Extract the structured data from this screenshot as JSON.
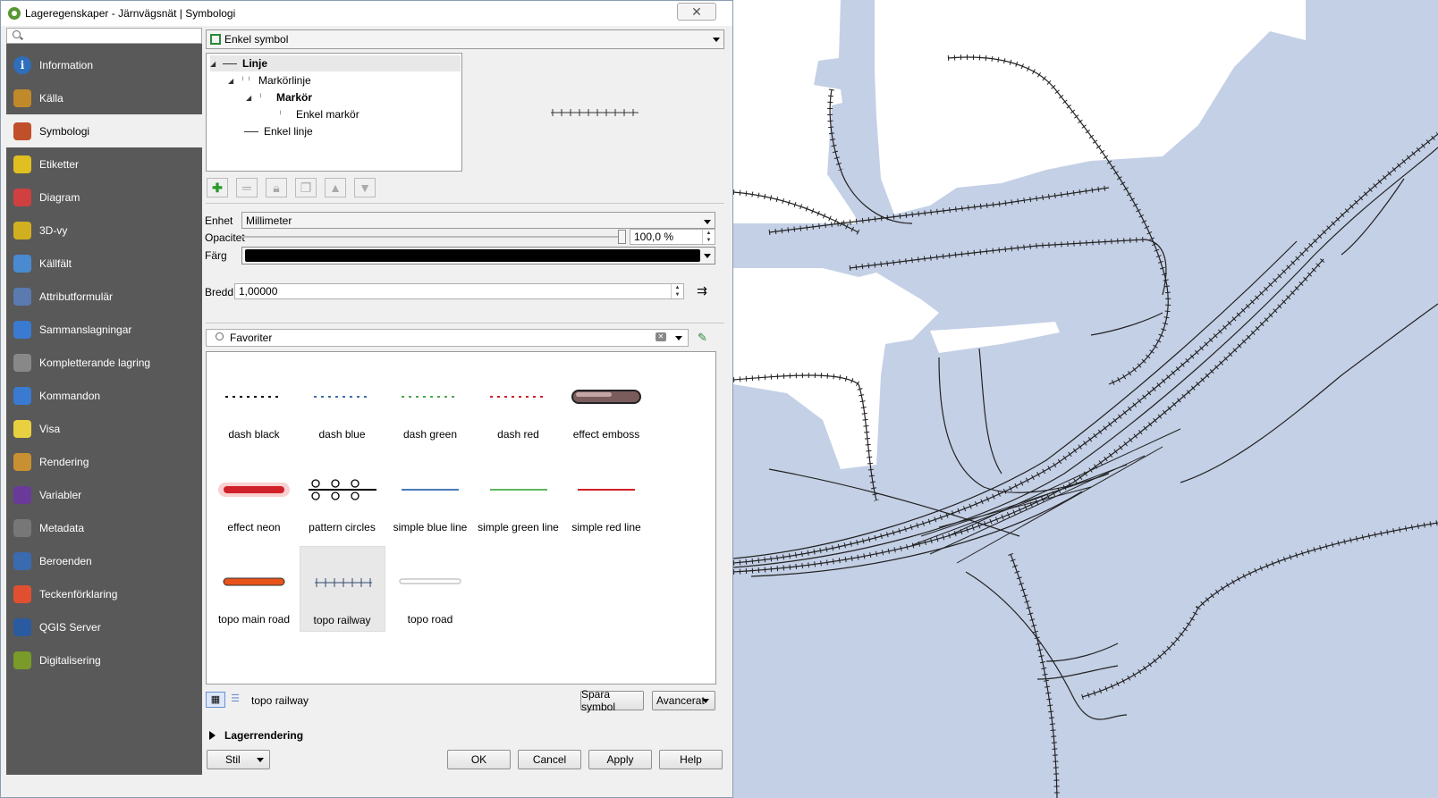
{
  "window": {
    "title": "Lageregenskaper - Järnvägsnät | Symbologi",
    "close_glyph": "✕"
  },
  "sidebar": {
    "items": [
      {
        "label": "Information",
        "icon": "info-icon"
      },
      {
        "label": "Källa",
        "icon": "source-icon"
      },
      {
        "label": "Symbologi",
        "icon": "symbology-icon",
        "active": true
      },
      {
        "label": "Etiketter",
        "icon": "labels-icon"
      },
      {
        "label": "Diagram",
        "icon": "diagram-icon"
      },
      {
        "label": "3D-vy",
        "icon": "3d-icon"
      },
      {
        "label": "Källfält",
        "icon": "source-fields-icon"
      },
      {
        "label": "Attributformulär",
        "icon": "attribute-form-icon"
      },
      {
        "label": "Sammanslagningar",
        "icon": "joins-icon"
      },
      {
        "label": "Kompletterande lagring",
        "icon": "auxiliary-storage-icon"
      },
      {
        "label": "Kommandon",
        "icon": "actions-icon"
      },
      {
        "label": "Visa",
        "icon": "display-icon"
      },
      {
        "label": "Rendering",
        "icon": "rendering-icon"
      },
      {
        "label": "Variabler",
        "icon": "variables-icon"
      },
      {
        "label": "Metadata",
        "icon": "metadata-icon"
      },
      {
        "label": "Beroenden",
        "icon": "dependencies-icon"
      },
      {
        "label": "Teckenförklaring",
        "icon": "legend-icon"
      },
      {
        "label": "QGIS Server",
        "icon": "qgis-server-icon"
      },
      {
        "label": "Digitalisering",
        "icon": "digitizing-icon"
      }
    ]
  },
  "renderer": {
    "selected": "Enkel symbol"
  },
  "tree": {
    "rows": [
      {
        "label": "Linje",
        "bold": true
      },
      {
        "label": "Markörlinje",
        "bold": false
      },
      {
        "label": "Markör",
        "bold": true
      },
      {
        "label": "Enkel markör",
        "bold": false
      },
      {
        "label": "Enkel linje",
        "bold": false
      }
    ]
  },
  "properties": {
    "unit_label": "Enhet",
    "unit_value": "Millimeter",
    "opacity_label": "Opacitet",
    "opacity_value": "100,0 %",
    "opacity_level": 1.0,
    "color_label": "Färg",
    "color_value": "#000000",
    "width_label": "Bredd",
    "width_value": "1,00000"
  },
  "library": {
    "search_value": "Favoriter",
    "symbols": [
      {
        "label": "dash  black",
        "kind": "dash",
        "color": "#000000"
      },
      {
        "label": "dash blue",
        "kind": "dash",
        "color": "#3d6ea8"
      },
      {
        "label": "dash green",
        "kind": "dash",
        "color": "#4ca84c"
      },
      {
        "label": "dash red",
        "kind": "dash",
        "color": "#d0202a"
      },
      {
        "label": "effect emboss",
        "kind": "emboss",
        "color": "#7a5c5c"
      },
      {
        "label": "effect neon",
        "kind": "neon",
        "color": "#d0202a"
      },
      {
        "label": "pattern circles",
        "kind": "circles",
        "color": "#000000"
      },
      {
        "label": "simple blue line",
        "kind": "line",
        "color": "#4a7ab8"
      },
      {
        "label": "simple green line",
        "kind": "line",
        "color": "#5cb85c"
      },
      {
        "label": "simple red line",
        "kind": "line",
        "color": "#d0202a"
      },
      {
        "label": "topo main road",
        "kind": "road",
        "color": "#e8531a"
      },
      {
        "label": "topo railway",
        "kind": "railway",
        "color": "#2f4a6e",
        "selected": true
      },
      {
        "label": "topo road",
        "kind": "lightroad",
        "color": "#bbbbbb"
      }
    ],
    "selected_name": "topo railway",
    "save_label": "Spara symbol",
    "advanced_label": "Avancerat"
  },
  "layer_rendering": {
    "label": "Lagerrendering"
  },
  "footer": {
    "style_label": "Stil",
    "ok_label": "OK",
    "cancel_label": "Cancel",
    "apply_label": "Apply",
    "help_label": "Help"
  },
  "map": {
    "water_color": "#c4d0e6",
    "land_color": "#ffffff"
  }
}
